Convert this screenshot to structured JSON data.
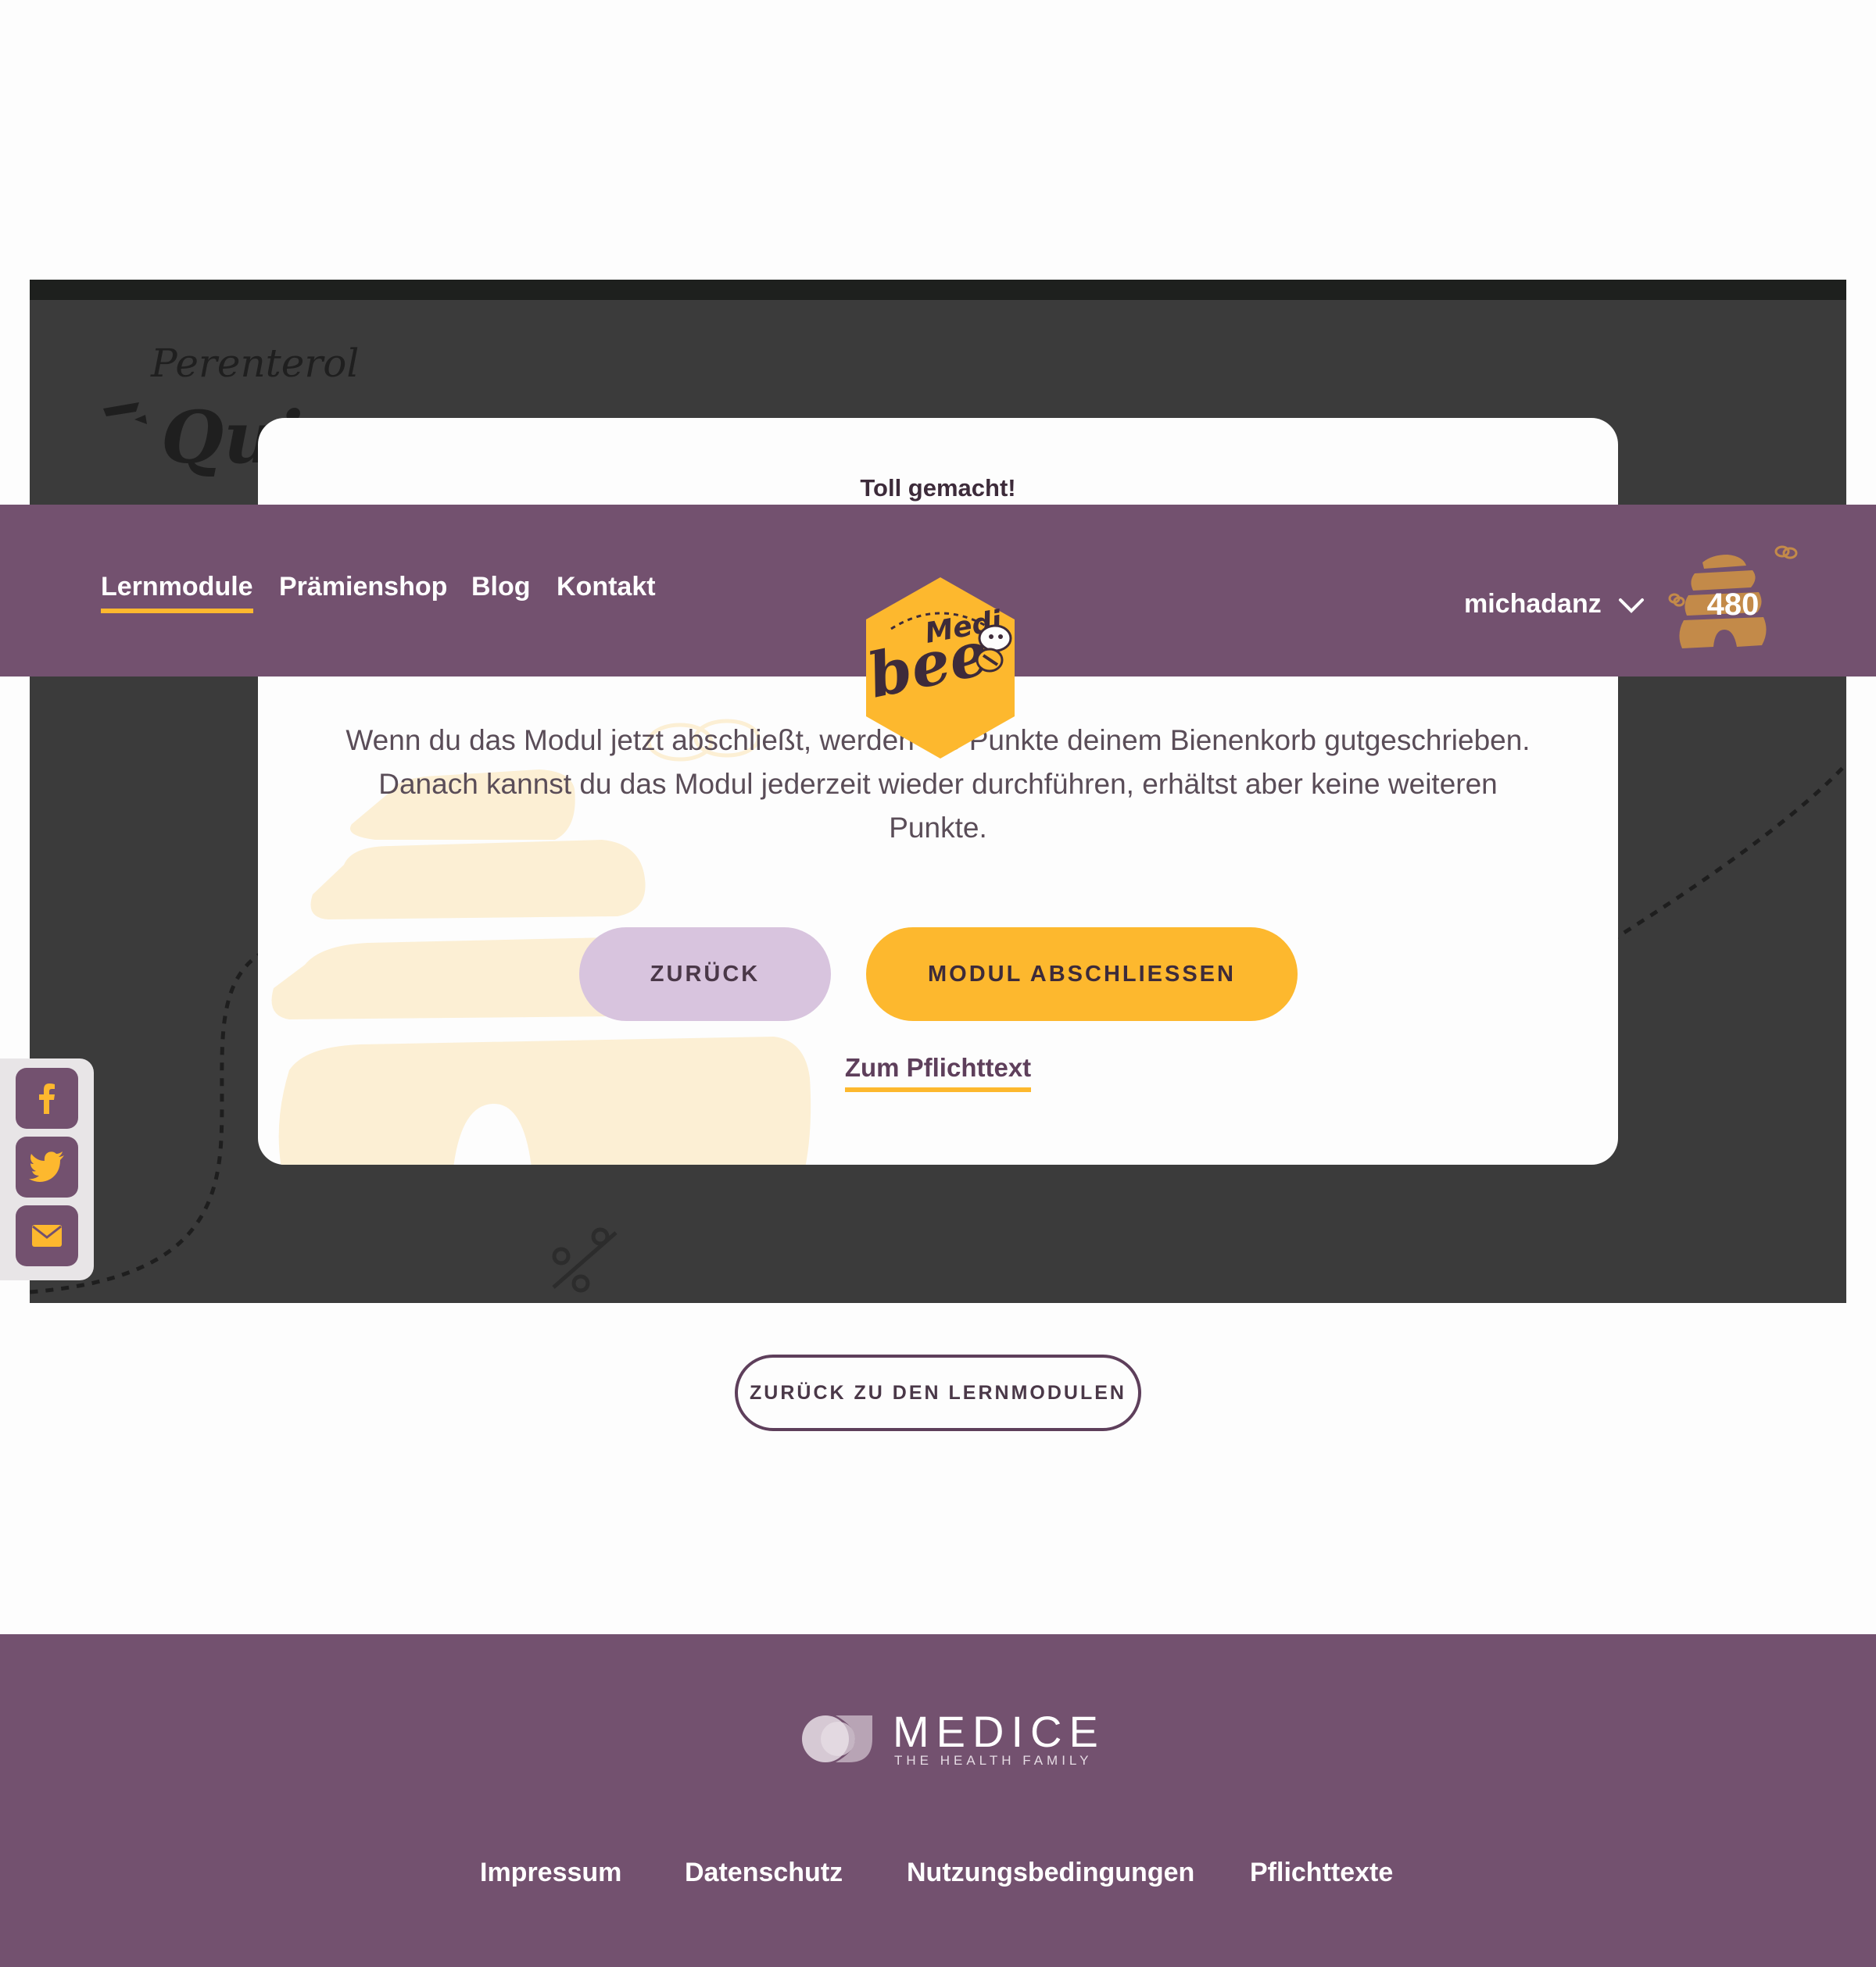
{
  "frame": {
    "brand": "Perenterol",
    "heading_fragment": "Qui"
  },
  "modal": {
    "title": "Toll gemacht!",
    "text": "Wenn du das Modul jetzt abschließt, werden die Punkte deinem Bienenkorb gutgeschrieben. Danach kannst du das Modul jederzeit wieder durchführen, erhältst aber keine weiteren Punkte.",
    "back_label": "ZURÜCK",
    "finish_label": "MODUL ABSCHLIESSEN",
    "link_label": "Zum Pflichttext"
  },
  "nav": {
    "items": [
      {
        "label": "Lernmodule",
        "active": true
      },
      {
        "label": "Prämienshop"
      },
      {
        "label": "Blog"
      },
      {
        "label": "Kontakt"
      }
    ],
    "username": "michadanz",
    "points": "480"
  },
  "logo": {
    "line1": "Medi",
    "line2": "bee"
  },
  "share": {
    "icons": [
      "facebook-icon",
      "twitter-icon",
      "email-icon"
    ]
  },
  "back_to_modules_label": "ZURÜCK ZU DEN LERNMODULEN",
  "footer": {
    "brand": "MEDICE",
    "tagline": "THE HEALTH FAMILY",
    "links": [
      "Impressum",
      "Datenschutz",
      "Nutzungsbedingungen",
      "Pflichttexte"
    ]
  },
  "colors": {
    "purple": "#73516f",
    "yellow": "#fdb82e",
    "lavender": "#d8c4de",
    "dark_overlay": "#3b3b3b"
  }
}
